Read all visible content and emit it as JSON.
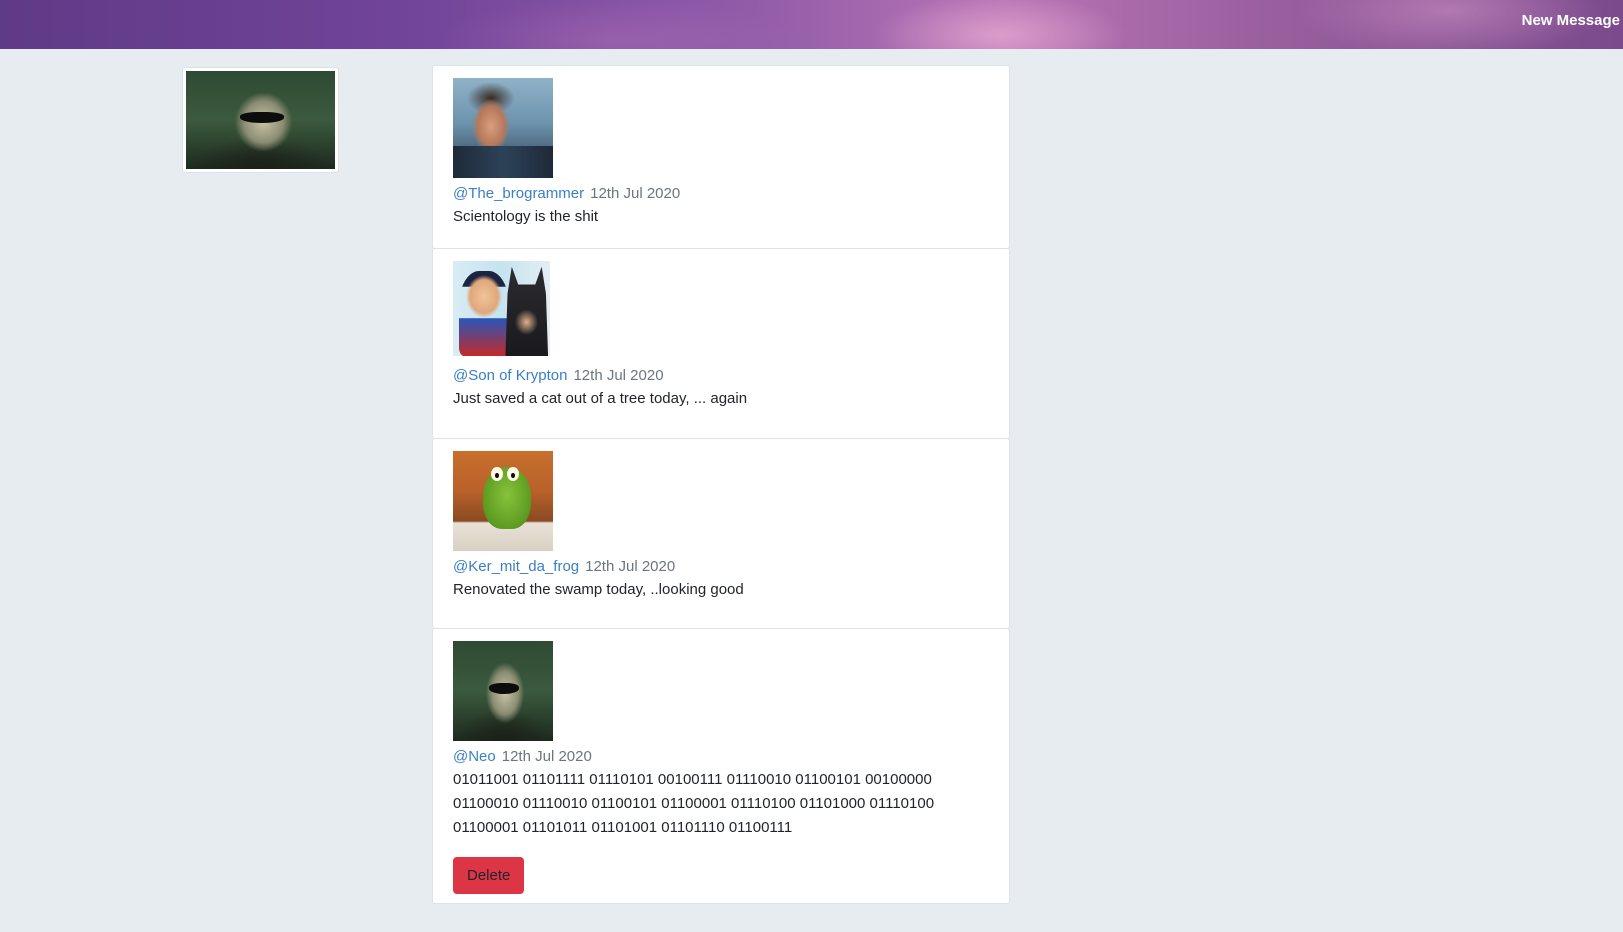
{
  "header": {
    "new_message_label": "New Message"
  },
  "profile": {
    "avatar_icon": "neo-avatar"
  },
  "posts": [
    {
      "handle": "@The_brogrammer",
      "date": "12th Jul 2020",
      "text": "Scientology is the shit",
      "avatar_icon": "brogrammer-avatar"
    },
    {
      "handle": "@Son of Krypton",
      "date": "12th Jul 2020",
      "text": "Just saved a cat out of a tree today, ... again",
      "avatar_icon": "superman-batman-avatar"
    },
    {
      "handle": "@Ker_mit_da_frog",
      "date": "12th Jul 2020",
      "text": "Renovated the swamp today, ..looking good",
      "avatar_icon": "kermit-avatar"
    },
    {
      "handle": "@Neo",
      "date": "12th Jul 2020",
      "text_lines": [
        "01011001 01101111 01110101 00100111 01110010 01100101 00100000",
        "01100010 01110010 01100101 01100001 01110100 01101000 01110100",
        "01100001 01101011 01101001 01101110 01100111"
      ],
      "delete_label": "Delete",
      "avatar_icon": "neo-avatar"
    }
  ],
  "colors": {
    "page_bg": "#e6ecf0",
    "link": "#3a7fc4",
    "delete_bg": "#dc3545",
    "date_text": "#6c757d"
  }
}
